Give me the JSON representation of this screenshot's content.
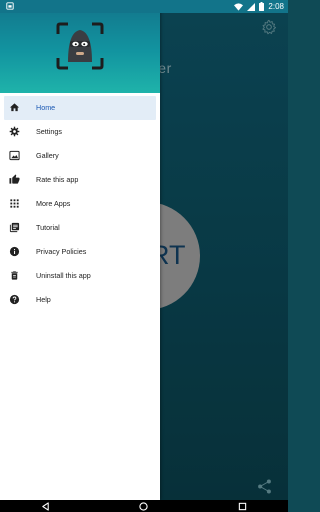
{
  "status_bar": {
    "time": "2:08",
    "icons": [
      "notification-icon",
      "wifi-icon",
      "signal-icon",
      "battery-icon"
    ]
  },
  "background": {
    "title_fragment": "ner",
    "button_fragment": "RT",
    "icons": [
      "gear-icon",
      "share-icon"
    ]
  },
  "drawer": {
    "header_logo": "masked-face-logo",
    "items": [
      {
        "label": "Home",
        "icon": "home-icon",
        "active": true
      },
      {
        "label": "Settings",
        "icon": "settings-icon",
        "active": false
      },
      {
        "label": "Gallery",
        "icon": "gallery-icon",
        "active": false
      },
      {
        "label": "Rate this app",
        "icon": "thumbs-up-icon",
        "active": false
      },
      {
        "label": "More Apps",
        "icon": "apps-grid-icon",
        "active": false
      },
      {
        "label": "Tutorial",
        "icon": "library-icon",
        "active": false
      },
      {
        "label": "Privacy Policies",
        "icon": "info-icon",
        "active": false
      },
      {
        "label": "Uninstall this app",
        "icon": "delete-icon",
        "active": false
      },
      {
        "label": "Help",
        "icon": "help-icon",
        "active": false
      }
    ]
  },
  "nav_bar": {
    "buttons": [
      "back-icon",
      "home-circle-icon",
      "recents-icon"
    ]
  },
  "colors": {
    "header_top": "#12748a",
    "header_bottom": "#1fb3aa",
    "active_item_bg": "#e3edf7",
    "active_item_text": "#1a58b3",
    "app_bg": "#0b4250"
  }
}
